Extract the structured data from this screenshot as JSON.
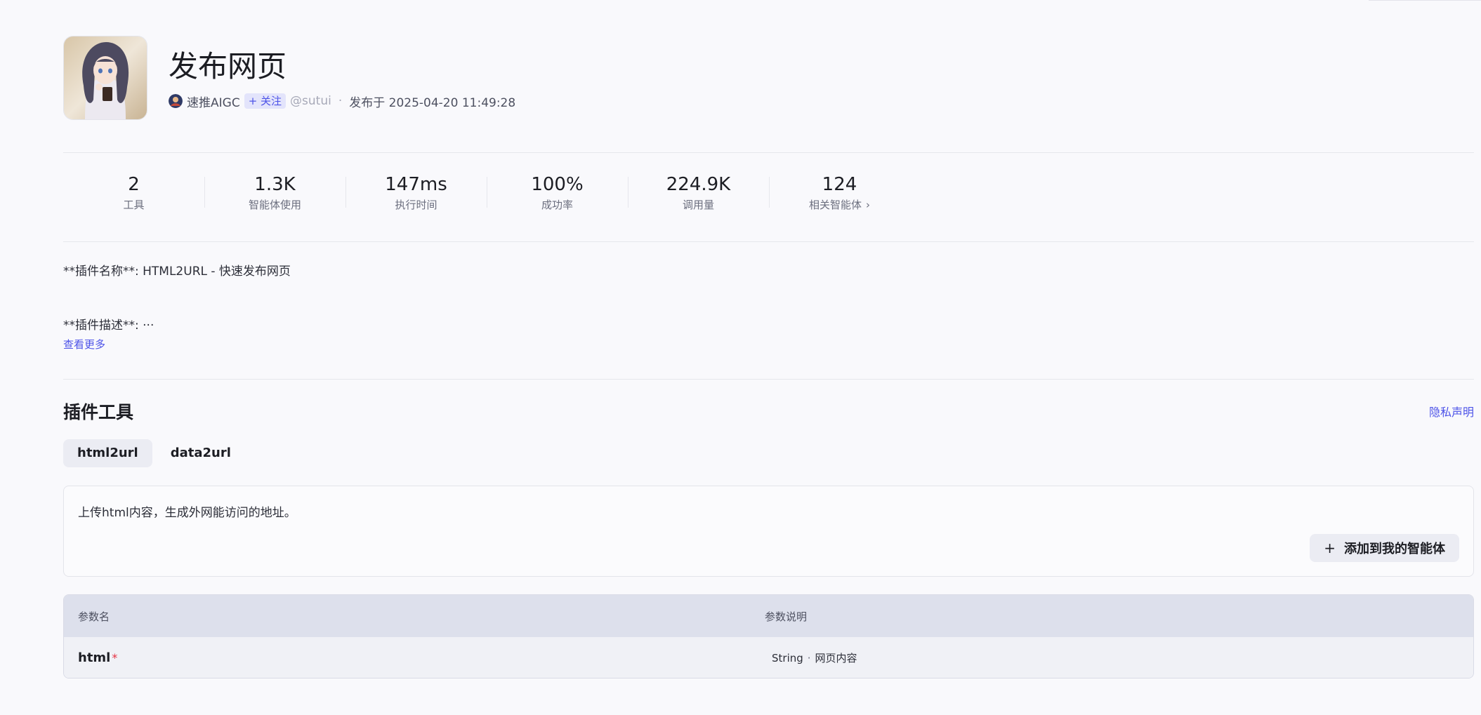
{
  "plugin": {
    "title": "发布网页",
    "author": "速推AIGC",
    "follow_label": "+ 关注",
    "handle": "@sutui",
    "separator": "·",
    "published": "发布于 2025-04-20 11:49:28"
  },
  "stats": [
    {
      "value": "2",
      "label": "工具"
    },
    {
      "value": "1.3K",
      "label": "智能体使用"
    },
    {
      "value": "147ms",
      "label": "执行时间"
    },
    {
      "value": "100%",
      "label": "成功率"
    },
    {
      "value": "224.9K",
      "label": "调用量"
    },
    {
      "value": "124",
      "label": "相关智能体"
    }
  ],
  "description": {
    "line1": "**插件名称**: HTML2URL - 快速发布网页",
    "line2": "**插件描述**: ···",
    "see_more": "查看更多"
  },
  "tools_section": {
    "title": "插件工具",
    "privacy": "隐私声明",
    "tabs": [
      "html2url",
      "data2url"
    ],
    "active_tab": "html2url",
    "tool_description": "上传html内容，生成外网能访问的地址。",
    "add_button": "添加到我的智能体",
    "table": {
      "headers": [
        "参数名",
        "参数说明"
      ],
      "rows": [
        {
          "name": "html",
          "required": "*",
          "type": "String",
          "desc": "网页内容"
        }
      ],
      "type_separator": "·"
    }
  },
  "icons": {
    "plus": "plus-icon",
    "chevron": "chevron-right-icon"
  },
  "colors": {
    "accent": "#4d53e8",
    "required": "#e53242",
    "background": "#f9f9fc"
  }
}
